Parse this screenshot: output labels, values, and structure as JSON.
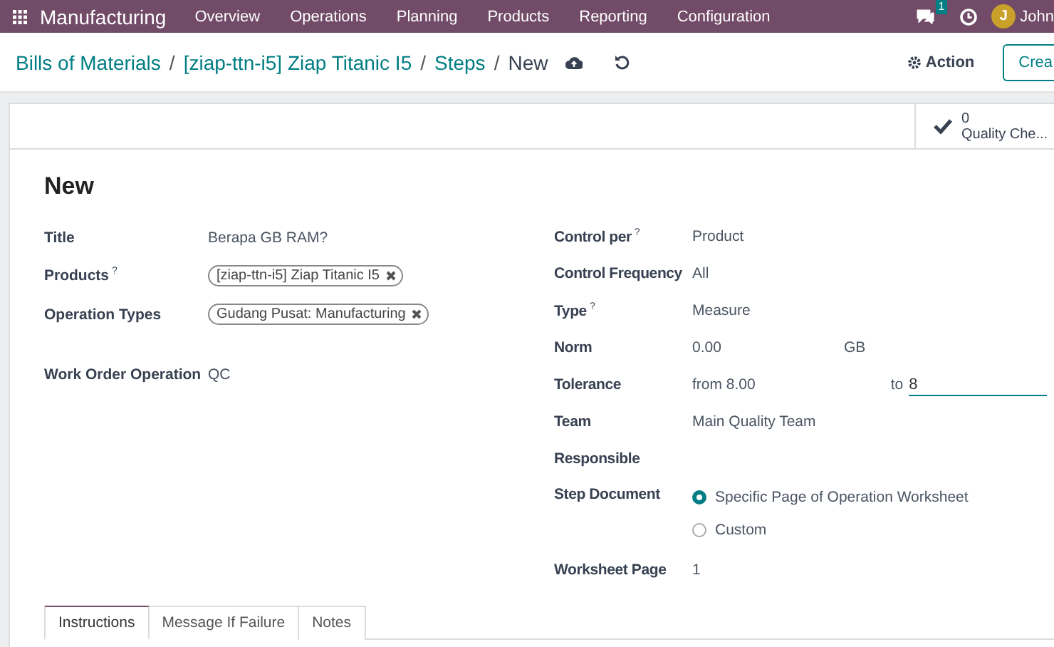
{
  "navbar": {
    "app": "Manufacturing",
    "menu": [
      "Overview",
      "Operations",
      "Planning",
      "Products",
      "Reporting",
      "Configuration"
    ],
    "chat_count": "1",
    "user_initial": "J",
    "user_name": "John"
  },
  "breadcrumb": {
    "links": [
      "Bills of Materials",
      "[ziap-ttn-i5] Ziap Titanic I5",
      "Steps"
    ],
    "separator": "/",
    "current": "New"
  },
  "actions": {
    "action": "Action",
    "create": "Crea"
  },
  "stat_button": {
    "count": "0",
    "label": "Quality Che..."
  },
  "form": {
    "heading": "New",
    "left_fields": [
      {
        "kind": "text",
        "label": "Title",
        "value": "Berapa GB RAM?"
      },
      {
        "kind": "tags",
        "label": "Products",
        "help": "?",
        "tags": [
          "[ziap-ttn-i5] Ziap Titanic I5"
        ]
      },
      {
        "kind": "tags",
        "label": "Operation Types",
        "tags": [
          "Gudang Pusat: Manufacturing"
        ]
      },
      {
        "kind": "text",
        "label": "Work Order Operation",
        "value": "QC"
      }
    ],
    "right_fields": [
      {
        "kind": "text",
        "label": "Control per",
        "help": "?",
        "value": "Product"
      },
      {
        "kind": "text",
        "label": "Control Frequency",
        "value": "All"
      },
      {
        "kind": "text",
        "label": "Type",
        "help": "?",
        "value": "Measure"
      },
      {
        "kind": "unit",
        "label": "Norm",
        "value": "0.00",
        "unit": "GB"
      },
      {
        "kind": "range",
        "label": "Tolerance",
        "from_label": "from",
        "from": "8.00",
        "to_label": "to",
        "to": "8"
      },
      {
        "kind": "text",
        "label": "Team",
        "value": "Main Quality Team"
      },
      {
        "kind": "text",
        "label": "Responsible"
      },
      {
        "kind": "radio",
        "label": "Step Document",
        "options": [
          {
            "label": "Specific Page of Operation Worksheet",
            "selected": true
          },
          {
            "label": "Custom",
            "selected": false
          }
        ]
      },
      {
        "kind": "text",
        "label": "Worksheet Page",
        "value": "1"
      }
    ]
  },
  "tabs": [
    {
      "label": "Instructions",
      "selected": true
    },
    {
      "label": "Message If Failure",
      "selected": false
    },
    {
      "label": "Notes",
      "selected": false
    }
  ]
}
